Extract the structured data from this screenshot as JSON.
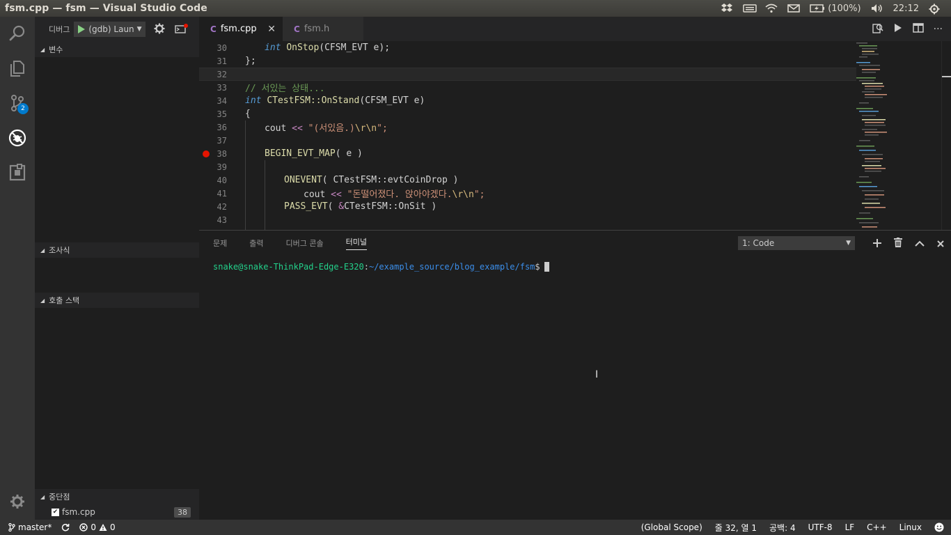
{
  "window": {
    "title": "fsm.cpp — fsm — Visual Studio Code",
    "tray": {
      "battery": "(100%)",
      "clock": "22:12"
    }
  },
  "activity": {
    "scm_badge": "2"
  },
  "sidebar": {
    "debug_label": "디버그",
    "config_name": "(gdb) Laun",
    "sections": {
      "variables": "변수",
      "watch": "조사식",
      "callstack": "호출 스택",
      "breakpoints": "중단점"
    },
    "breakpoint": {
      "file": "fsm.cpp",
      "line": "38"
    }
  },
  "tabs": [
    {
      "label": "fsm.cpp",
      "active": true
    },
    {
      "label": "fsm.h",
      "active": false
    }
  ],
  "editor": {
    "lines": [
      {
        "n": "30"
      },
      {
        "n": "31"
      },
      {
        "n": "32"
      },
      {
        "n": "33"
      },
      {
        "n": "34"
      },
      {
        "n": "35"
      },
      {
        "n": "36"
      },
      {
        "n": "37"
      },
      {
        "n": "38"
      },
      {
        "n": "39"
      },
      {
        "n": "40"
      },
      {
        "n": "41"
      },
      {
        "n": "42"
      },
      {
        "n": "43"
      }
    ],
    "code": {
      "l30_kw": "int",
      "l30_fn": "OnStop",
      "l30_rest": "(CFSM_EVT e);",
      "l31": "};",
      "l33": "// 서있는 상태...",
      "l34_kw": "int",
      "l34_fn": "CTestFSM::OnStand",
      "l34_rest": "(CFSM_EVT e)",
      "l35": "{",
      "l36_a": "cout ",
      "l36_op": "<<",
      "l36_str": " \"(서있음.)",
      "l36_esc": "\\r\\n",
      "l36_end": "\";",
      "l38_mac": "BEGIN_EVT_MAP",
      "l38_rest": "( e )",
      "l40_mac": "ONEVENT",
      "l40_rest": "( CTestFSM::evtCoinDrop )",
      "l41_a": "cout ",
      "l41_op": "<<",
      "l41_str": " \"돈떨어졌다. 앉아야겠다.",
      "l41_esc": "\\r\\n",
      "l41_end": "\";",
      "l42_mac": "PASS_EVT",
      "l42_a": "( ",
      "l42_op": "&",
      "l42_rest": "CTestFSM::OnSit )"
    }
  },
  "panel": {
    "tabs": [
      "문제",
      "출력",
      "디버그 콘솔",
      "터미널"
    ],
    "active_tab": "터미널",
    "terminal_select": "1: Code",
    "prompt_user": "snake@snake-ThinkPad-Edge-E320",
    "prompt_colon": ":",
    "prompt_path": "~/example_source/blog_example/fsm",
    "prompt_sym": "$"
  },
  "statusbar": {
    "branch": "master*",
    "errors": "0",
    "warnings": "0",
    "scope": "(Global Scope)",
    "position": "줄 32, 열 1",
    "spaces": "공백: 4",
    "encoding": "UTF-8",
    "eol": "LF",
    "language": "C++",
    "platform": "Linux"
  },
  "colors": {
    "accent": "#007acc",
    "breakpoint": "#e51400",
    "terminal_user": "#23d18b",
    "terminal_path": "#3b8eea"
  }
}
